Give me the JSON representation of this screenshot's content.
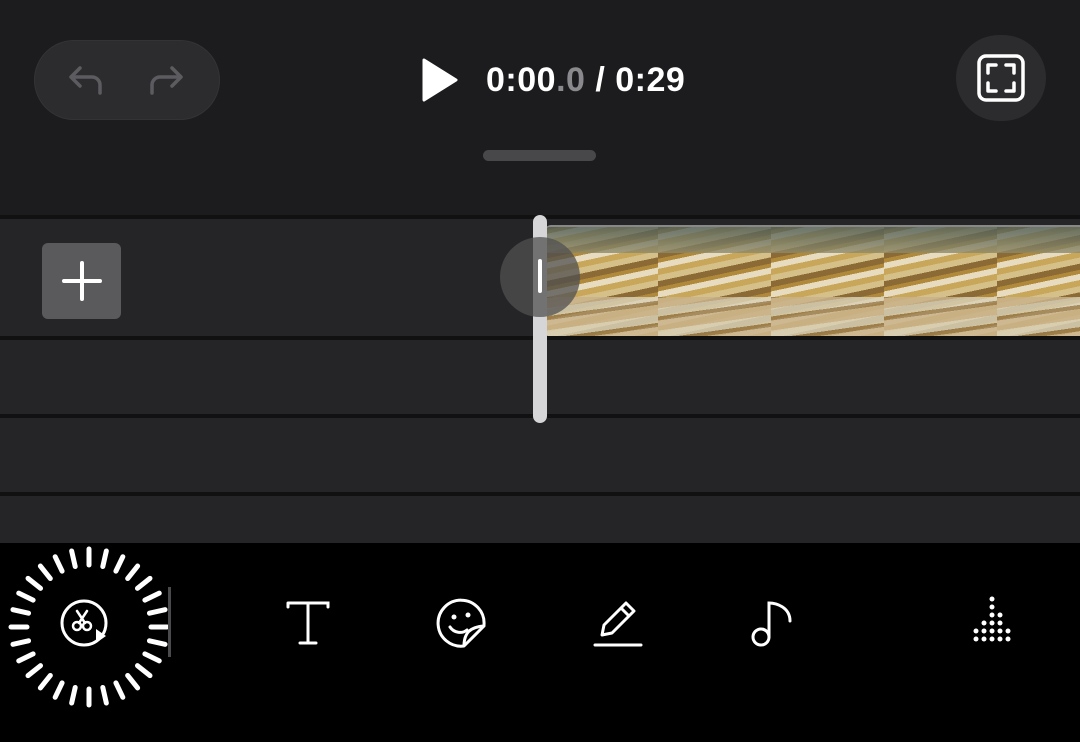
{
  "header": {
    "time_current_main": "0:00",
    "time_current_fraction": ".0",
    "time_separator": " / ",
    "time_total": "0:29"
  },
  "icons": {
    "undo": "undo-arrow-icon",
    "redo": "redo-arrow-icon",
    "play": "play-icon",
    "fullscreen": "fullscreen-icon",
    "add_clip": "plus-icon",
    "trim": "scissors-play-icon",
    "text": "text-icon",
    "sticker": "sticker-icon",
    "draw": "pencil-icon",
    "music": "music-note-icon",
    "more": "equalizer-dots-icon"
  },
  "colors": {
    "background": "#1c1c1e",
    "timeline": "#252527",
    "toolbar": "#000000",
    "playhead": "#d6d6d8"
  }
}
